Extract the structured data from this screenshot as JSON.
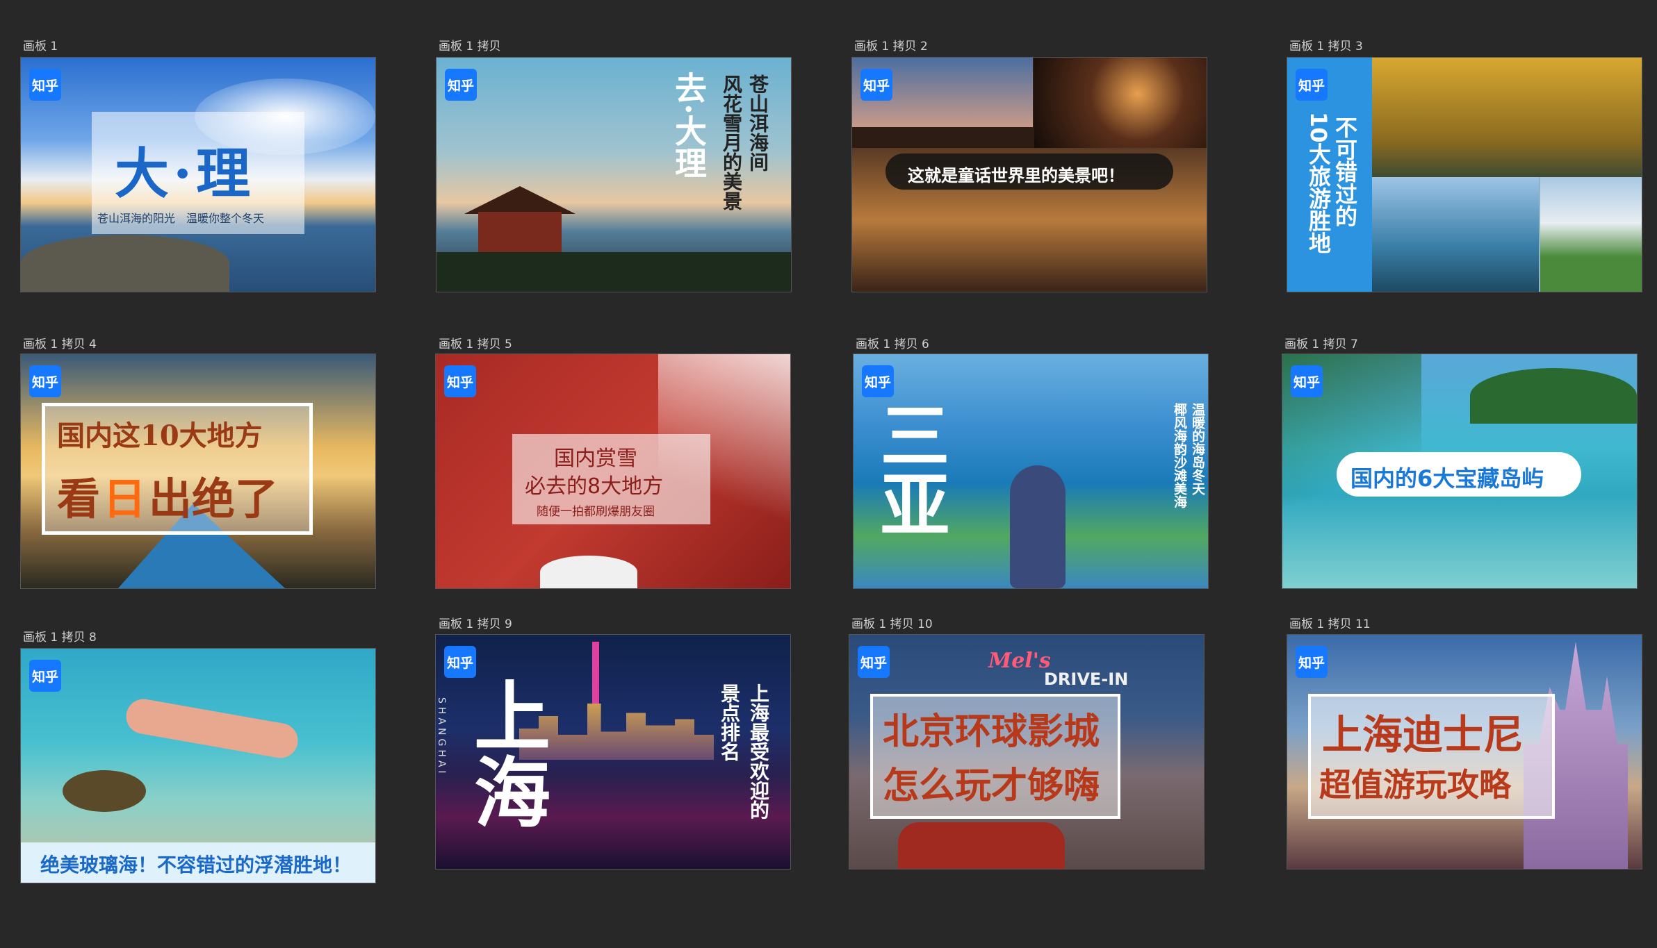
{
  "labels": {
    "a1": "画板 1",
    "a2": "画板 1 拷贝",
    "a3": "画板 1 拷贝 2",
    "a4": "画板 1 拷贝 3",
    "a5": "画板 1 拷贝 4",
    "a6": "画板 1 拷贝 5",
    "a7": "画板 1 拷贝 6",
    "a8": "画板 1 拷贝 7",
    "a9": "画板 1 拷贝 8",
    "a10": "画板 1 拷贝 9",
    "a11": "画板 1 拷贝 10",
    "a12": "画板 1 拷贝 11"
  },
  "logo": "知乎",
  "covers": {
    "dali": {
      "title": "大·理",
      "subtitle": "苍山洱海的阳光　温暖你整个冬天"
    },
    "qudali": {
      "title": "去·大理",
      "line1": "苍山洱海间",
      "line2": "风花雪月的美景"
    },
    "fairy": {
      "caption": "这就是童话世界里的美景吧！"
    },
    "ten": {
      "line1": "不可错过的",
      "line2": "10大旅游胜地"
    },
    "sunrise": {
      "line1": "国内这10大地方",
      "line2a": "看",
      "line2b": "日",
      "line2c": "出绝了"
    },
    "snow": {
      "line1": "国内赏雪",
      "line2": "必去的8大地方",
      "line3": "随便一拍都刷爆朋友圈"
    },
    "sanya": {
      "title": "三亚",
      "line1": "温暖的海岛冬天",
      "line2": "椰风海韵沙滩美海"
    },
    "islands": {
      "title": "国内的6大宝藏岛屿"
    },
    "glass": {
      "title": "绝美玻璃海！不容错过的浮潜胜地！"
    },
    "shanghai": {
      "title": "上海",
      "en": "SHANGHAI",
      "line1": "上海最受欢迎的",
      "line2": "景点排名"
    },
    "universal": {
      "sign1": "Mel's",
      "sign2": "DRIVE-IN",
      "line1": "北京环球影城",
      "line2": "怎么玩才够嗨"
    },
    "disney": {
      "line1": "上海迪士尼",
      "line2": "超值游玩攻略"
    }
  },
  "colors": {
    "canvas": "#282828",
    "label": "#cfcfcf",
    "zhihu_blue": "#1677ff"
  }
}
